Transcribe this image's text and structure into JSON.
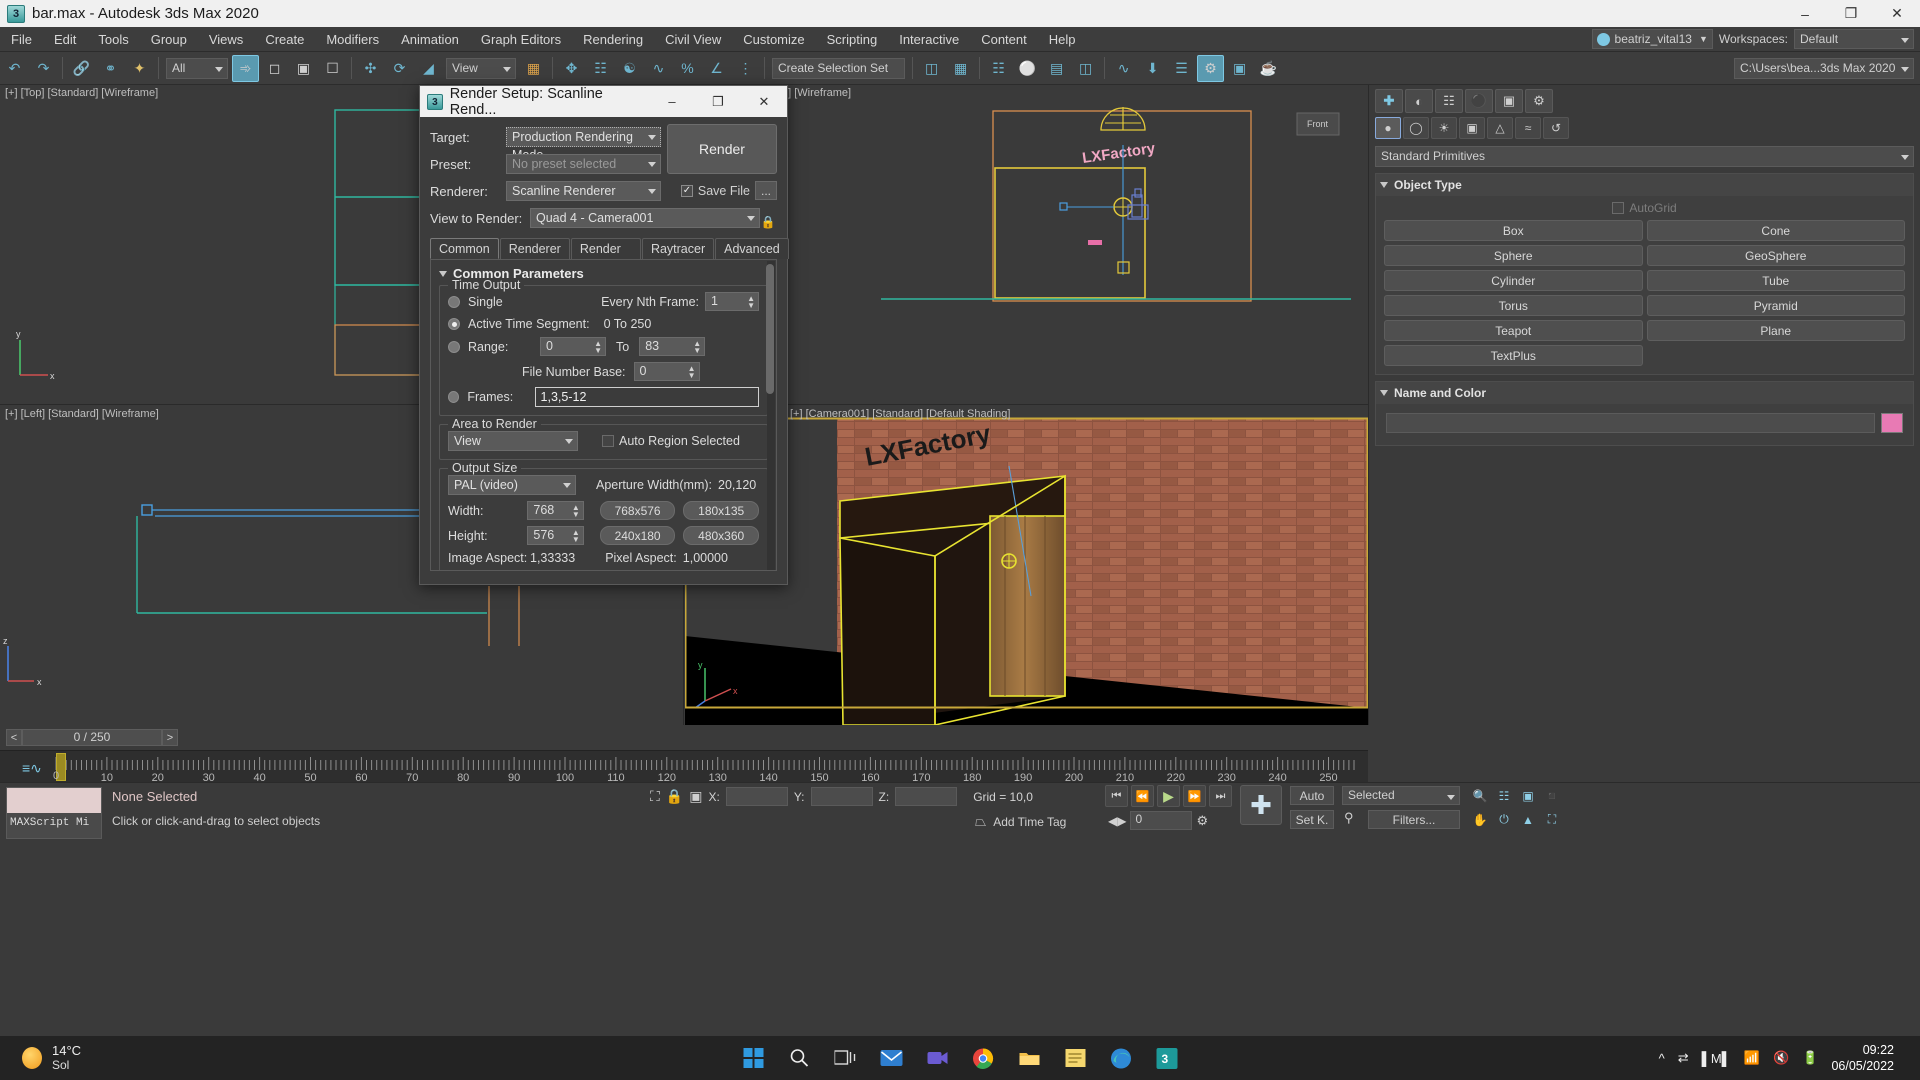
{
  "titlebar": {
    "app_icon": "3dsmax-icon",
    "title": "bar.max - Autodesk 3ds Max 2020",
    "minimize": "–",
    "maximize": "❐",
    "close": "✕"
  },
  "menubar": {
    "items": [
      "File",
      "Edit",
      "Tools",
      "Group",
      "Views",
      "Create",
      "Modifiers",
      "Animation",
      "Graph Editors",
      "Rendering",
      "Civil View",
      "Customize",
      "Scripting",
      "Interactive",
      "Content",
      "Help"
    ],
    "user": "beatriz_vital13",
    "workspaces_label": "Workspaces:",
    "workspace_value": "Default"
  },
  "toolbar": {
    "selection_filter": "All",
    "named_set": "Create Selection Set",
    "view_combo": "View",
    "project_path": "C:\\Users\\bea...3ds Max 2020",
    "icons": [
      "undo-icon",
      "redo-icon",
      "link-icon",
      "unlink-icon",
      "bind-space-warp-icon",
      "select-object-icon",
      "select-region-icon",
      "window-crossing-icon",
      "select-move-icon",
      "select-rotate-icon",
      "select-scale-icon",
      "reference-coord-icon",
      "pivot-icon",
      "mirror-icon",
      "align-icon",
      "snap-toggle-icon",
      "angle-snap-icon",
      "percent-snap-icon",
      "spinner-snap-icon",
      "layer-explorer-icon",
      "curve-editor-icon",
      "schematic-view-icon",
      "material-editor-icon",
      "render-setup-icon",
      "rendered-frame-icon",
      "render-production-icon"
    ]
  },
  "viewports": [
    {
      "name": "top",
      "label": "[+] [Top] [Standard] [Wireframe]"
    },
    {
      "name": "front",
      "label": "[+] [Front] [Standard] [Wireframe]"
    },
    {
      "name": "left",
      "label": "[+] [Left] [Standard] [Wireframe]"
    },
    {
      "name": "camera",
      "label": "[+] [Camera001] [Standard] [Default Shading]"
    }
  ],
  "command_panel": {
    "tabs": [
      "create-tab",
      "modify-tab",
      "hierarchy-tab",
      "motion-tab",
      "display-tab",
      "utilities-tab"
    ],
    "subtabs": [
      "geometry-icon",
      "shapes-icon",
      "lights-icon",
      "cameras-icon",
      "helpers-icon",
      "space-warps-icon",
      "systems-icon"
    ],
    "category": "Standard Primitives",
    "object_type": {
      "title": "Object Type",
      "autogrid_label": "AutoGrid",
      "buttons": [
        "Box",
        "Cone",
        "Sphere",
        "GeoSphere",
        "Cylinder",
        "Tube",
        "Torus",
        "Pyramid",
        "Teapot",
        "Plane",
        "TextPlus"
      ]
    },
    "name_and_color": {
      "title": "Name and Color",
      "name_value": "",
      "color": "#e87ab4"
    }
  },
  "timeslider": {
    "prev": "<",
    "next": ">",
    "frame_display": "0 / 250",
    "ruler_labels": [
      10,
      20,
      30,
      40,
      50,
      60,
      70,
      80,
      90,
      100,
      110,
      120,
      130,
      140,
      150,
      160,
      170,
      180,
      190,
      200,
      210,
      220,
      230,
      240,
      250
    ],
    "ruler_zero": "0"
  },
  "status": {
    "listener_label": "MAXScript Mi",
    "selection": "None Selected",
    "prompt": "Click or click-and-drag to select objects",
    "x_label": "X:",
    "x_value": "",
    "y_label": "Y:",
    "y_value": "",
    "z_label": "Z:",
    "z_value": "",
    "grid": "Grid = 10,0",
    "add_time_tag": "Add Time Tag",
    "auto_key": "Auto",
    "set_key": "Set K.",
    "selection_set": "Selected",
    "filters": "Filters...",
    "key_frame_value": "0"
  },
  "render_dialog": {
    "title": "Render Setup: Scanline Rend...",
    "minimize": "–",
    "maximize": "❐",
    "close": "✕",
    "target_label": "Target:",
    "target_value": "Production Rendering Mode",
    "preset_label": "Preset:",
    "preset_value": "No preset selected",
    "renderer_label": "Renderer:",
    "renderer_value": "Scanline Renderer",
    "view_label": "View to Render:",
    "view_value": "Quad 4 - Camera001",
    "render_button": "Render",
    "save_file_label": "Save File",
    "save_file_checked": true,
    "dots_button": "...",
    "lock_icon": "lock-icon",
    "tabs": [
      "Common",
      "Renderer",
      "Render Elements",
      "Raytracer",
      "Advanced Lighting"
    ],
    "active_tab": "Common",
    "common_parameters_title": "Common Parameters",
    "time_output": {
      "title": "Time Output",
      "single_label": "Single",
      "every_nth_label": "Every Nth Frame:",
      "every_nth_value": "1",
      "active_segment_label": "Active Time Segment:",
      "active_segment_value": "0 To 250",
      "range_label": "Range:",
      "range_from": "0",
      "range_to_label": "To",
      "range_to": "83",
      "file_number_base_label": "File Number Base:",
      "file_number_base": "0",
      "frames_label": "Frames:",
      "frames_value": "1,3,5-12",
      "selected": "active_segment"
    },
    "area_to_render": {
      "title": "Area to Render",
      "value": "View",
      "auto_region_label": "Auto Region Selected",
      "auto_region_checked": false
    },
    "output_size": {
      "title": "Output Size",
      "preset": "PAL (video)",
      "aperture_label": "Aperture Width(mm):",
      "aperture_value": "20,120",
      "width_label": "Width:",
      "width_value": "768",
      "height_label": "Height:",
      "height_value": "576",
      "size_buttons": [
        "768x576",
        "180x135",
        "240x180",
        "480x360"
      ],
      "image_aspect_label": "Image Aspect:",
      "image_aspect_value": "1,33333",
      "pixel_aspect_label": "Pixel Aspect:",
      "pixel_aspect_value": "1,00000"
    }
  },
  "taskbar": {
    "temperature": "14°C",
    "condition": "Sol",
    "apps": [
      "start-icon",
      "search-icon",
      "task-view-icon",
      "mail-icon",
      "teams-icon",
      "chrome-icon",
      "file-explorer-icon",
      "notepad-icon",
      "edge-icon",
      "3dsmax-icon"
    ],
    "tray": [
      "show-hidden-icons",
      "settings-icon",
      "equalizer-icon",
      "wifi-icon",
      "volume-muted-icon",
      "battery-charging-icon"
    ],
    "time": "09:22",
    "date": "06/05/2022"
  }
}
